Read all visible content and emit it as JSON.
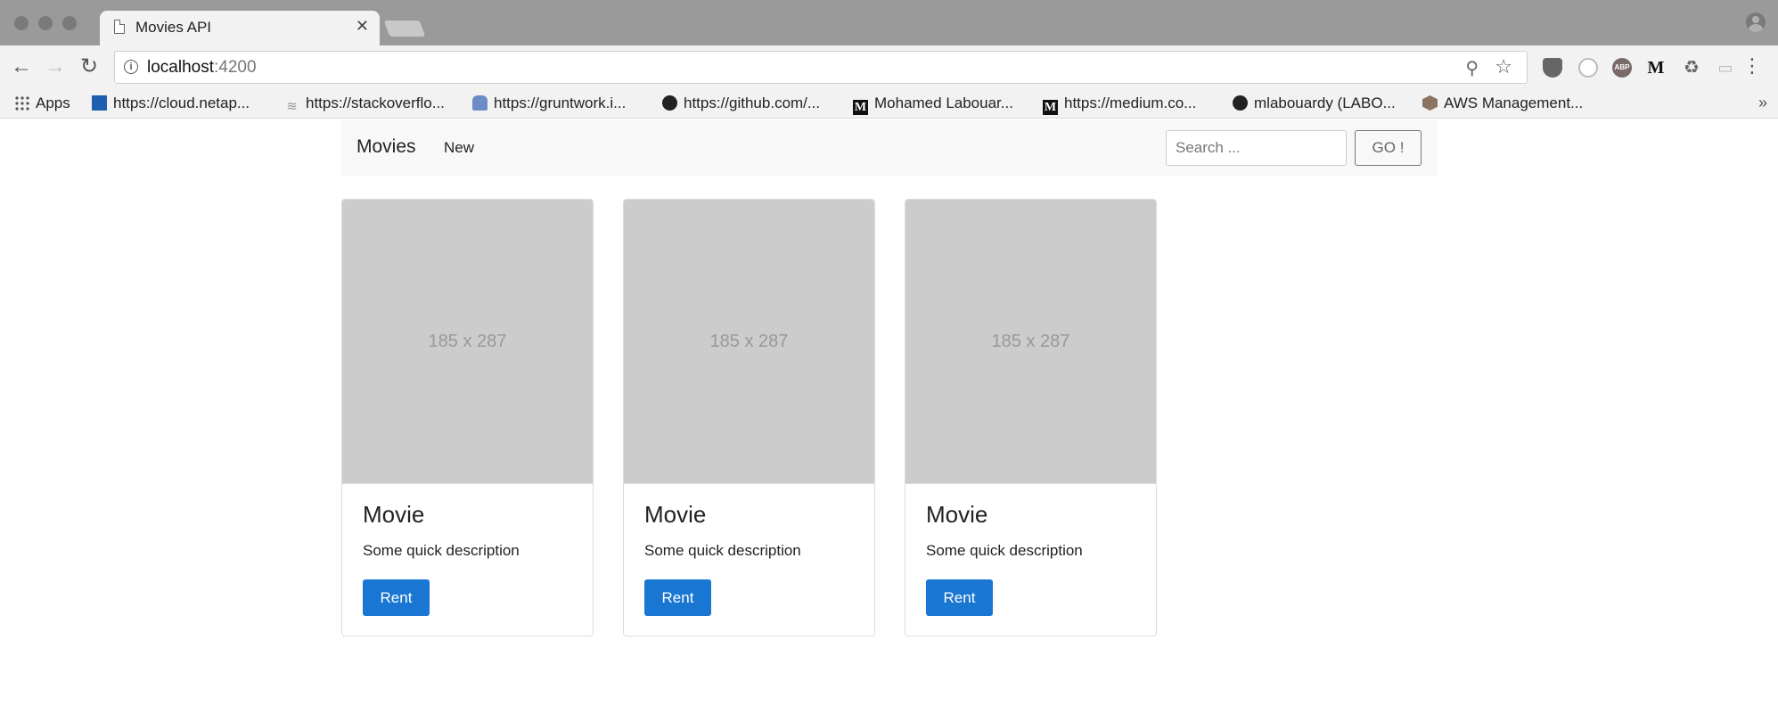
{
  "browser": {
    "tab_title": "Movies API",
    "url_host": "localhost",
    "url_port": ":4200",
    "bookmarks": [
      {
        "label": "Apps",
        "icon": "apps-grid-icon"
      },
      {
        "label": "https://cloud.netap...",
        "icon": "netapp-icon"
      },
      {
        "label": "https://stackoverflo...",
        "icon": "stackoverflow-icon"
      },
      {
        "label": "https://gruntwork.i...",
        "icon": "gruntwork-icon"
      },
      {
        "label": "https://github.com/...",
        "icon": "github-icon"
      },
      {
        "label": "Mohamed Labouar...",
        "icon": "medium-icon"
      },
      {
        "label": "https://medium.co...",
        "icon": "medium-icon"
      },
      {
        "label": "mlabouardy (LABO...",
        "icon": "github-icon"
      },
      {
        "label": "AWS Management...",
        "icon": "aws-icon"
      }
    ],
    "extensions": [
      "pocket-icon",
      "circle-extension-icon",
      "adblock-plus-icon",
      "medium-extension-icon",
      "recycle-icon",
      "cast-icon"
    ],
    "abp_label": "ABP",
    "medium_ext_label": "M"
  },
  "navbar": {
    "brand": "Movies",
    "new_link": "New",
    "search_placeholder": "Search ...",
    "go_label": "GO !"
  },
  "cards": [
    {
      "image_text": "185 x 287",
      "title": "Movie",
      "description": "Some quick description",
      "button": "Rent"
    },
    {
      "image_text": "185 x 287",
      "title": "Movie",
      "description": "Some quick description",
      "button": "Rent"
    },
    {
      "image_text": "185 x 287",
      "title": "Movie",
      "description": "Some quick description",
      "button": "Rent"
    }
  ],
  "colors": {
    "primary_button": "#1976d2",
    "navbar_bg": "#f8f8f8",
    "placeholder_bg": "#cccccc"
  }
}
